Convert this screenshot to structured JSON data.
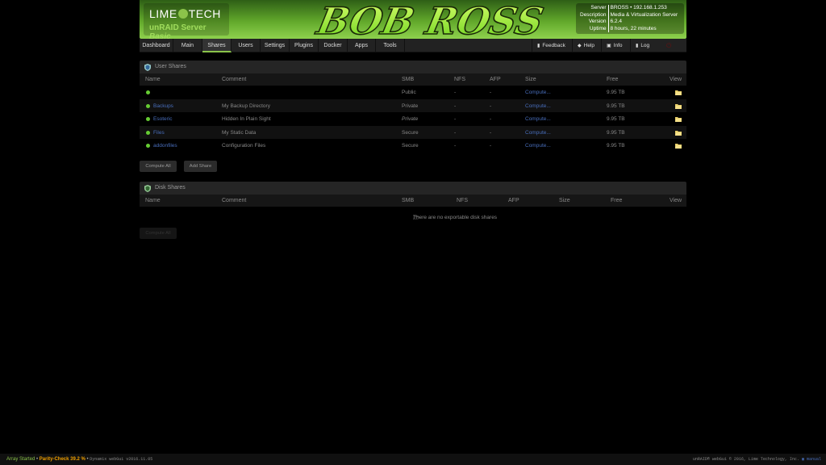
{
  "logo": {
    "lime": "LIME",
    "tech": "TECH",
    "product": "unRAID Server",
    "edition": "Basic"
  },
  "banner_text": "BOB ROSS",
  "sysinfo": {
    "rows": [
      {
        "k": "Server",
        "v": "BROSS • 192.168.1.253"
      },
      {
        "k": "Description",
        "v": "Media & Virtualization Server"
      },
      {
        "k": "Version",
        "v": "6.2.4"
      },
      {
        "k": "Uptime",
        "v": "8 hours, 22 minutes"
      }
    ]
  },
  "nav": {
    "tabs": [
      "Dashboard",
      "Main",
      "Shares",
      "Users",
      "Settings",
      "Plugins",
      "Docker",
      "Apps",
      "Tools"
    ],
    "active": "Shares",
    "right": [
      "Feedback",
      "Help",
      "Info",
      "Log"
    ]
  },
  "user_shares": {
    "title": "User Shares",
    "columns": [
      "Name",
      "Comment",
      "SMB",
      "NFS",
      "AFP",
      "Size",
      "Free",
      "View"
    ],
    "rows": [
      {
        "name": "",
        "comment": "",
        "smb": "Public",
        "nfs": "-",
        "afp": "-",
        "size": "Compute...",
        "free": "9.95 TB"
      },
      {
        "name": "Backups",
        "comment": "My Backup Directory",
        "smb": "Private",
        "nfs": "-",
        "afp": "-",
        "size": "Compute...",
        "free": "9.95 TB"
      },
      {
        "name": "Esoteric",
        "comment": "Hidden In Plain Sight",
        "smb": "Private",
        "nfs": "-",
        "afp": "-",
        "size": "Compute...",
        "free": "9.95 TB"
      },
      {
        "name": "Files",
        "comment": "My Static Data",
        "smb": "Secure",
        "nfs": "-",
        "afp": "-",
        "size": "Compute...",
        "free": "9.95 TB"
      },
      {
        "name": "addonfiles",
        "comment": "Configuration Files",
        "smb": "Secure",
        "nfs": "-",
        "afp": "-",
        "size": "Compute...",
        "free": "9.95 TB"
      }
    ],
    "compute_all": "Compute All",
    "add_share": "Add Share"
  },
  "disk_shares": {
    "title": "Disk Shares",
    "columns": [
      "Name",
      "Comment",
      "SMB",
      "NFS",
      "AFP",
      "Size",
      "Free",
      "View"
    ],
    "empty": "There are no exportable disk shares",
    "compute_all": "Compute All"
  },
  "footer": {
    "array": "Array Started",
    "parity": "Parity-Check 39.2 %",
    "webgui": "Dynamix webGui v2016.11.05",
    "copyright": "unRAID® webGui © 2016, Lime Technology, Inc.",
    "manual": "manual"
  },
  "colors": {
    "accent": "#8bc34a",
    "link": "#486dba",
    "status_green": "#66cc33",
    "parity": "#f0a000"
  }
}
